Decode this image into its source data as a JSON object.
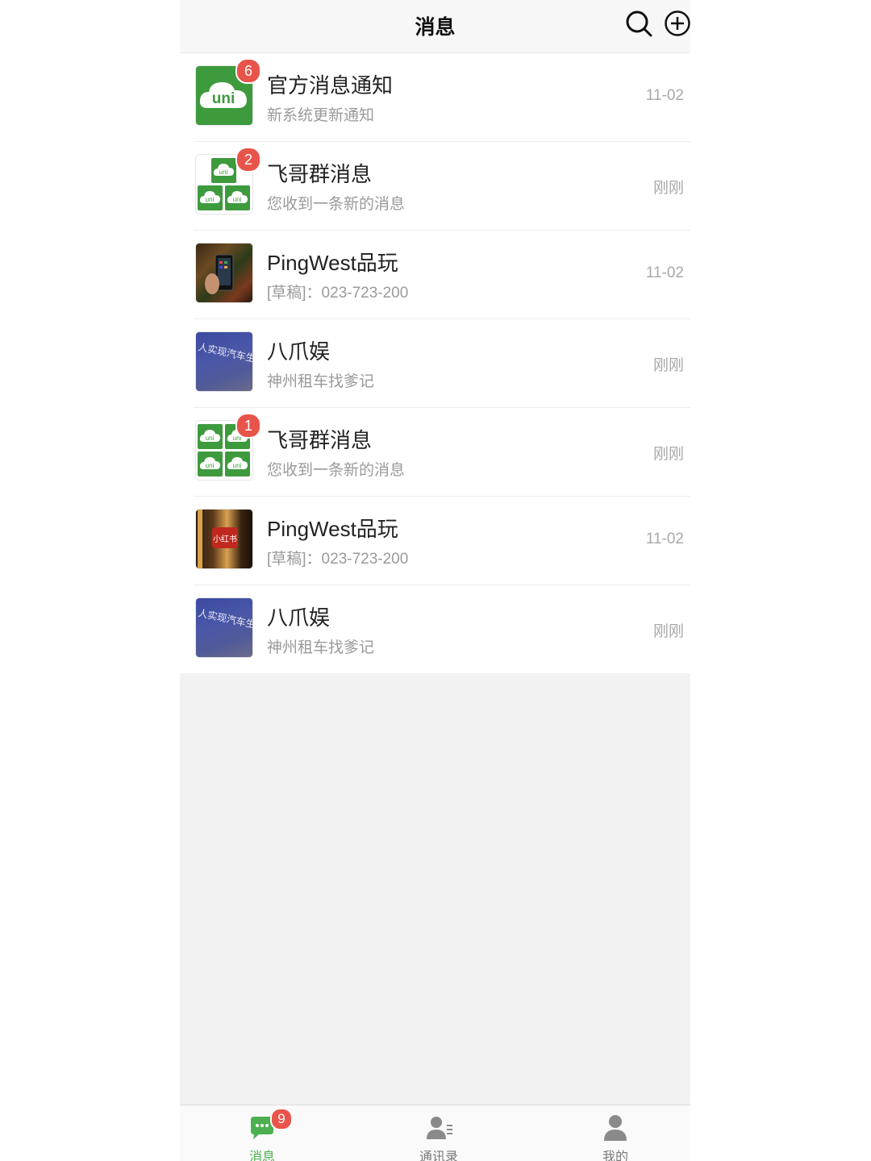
{
  "header": {
    "title": "消息",
    "search_icon": "search-icon",
    "add_icon": "plus-circle-icon"
  },
  "conversations": [
    {
      "title": "官方消息通知",
      "subtitle": "新系统更新通知",
      "time": "11-02",
      "badge": "6",
      "avatar": "uni-logo"
    },
    {
      "title": "飞哥群消息",
      "subtitle": "您收到一条新的消息",
      "time": "刚刚",
      "badge": "2",
      "avatar": "uni-group-3"
    },
    {
      "title": "PingWest品玩",
      "subtitle": "[草稿]：023-723-200",
      "time": "11-02",
      "badge": null,
      "avatar": "photo-phone"
    },
    {
      "title": "八爪娱",
      "subtitle": "神州租车找爹记",
      "time": "刚刚",
      "badge": null,
      "avatar": "photo-sign"
    },
    {
      "title": "飞哥群消息",
      "subtitle": "您收到一条新的消息",
      "time": "刚刚",
      "badge": "1",
      "avatar": "uni-group-4"
    },
    {
      "title": "PingWest品玩",
      "subtitle": "[草稿]：023-723-200",
      "time": "11-02",
      "badge": null,
      "avatar": "photo-shop"
    },
    {
      "title": "八爪娱",
      "subtitle": "神州租车找爹记",
      "time": "刚刚",
      "badge": null,
      "avatar": "photo-sign"
    }
  ],
  "avatar_text": {
    "uni": "uni",
    "sign": "人实现汽车生",
    "shop": "小红书"
  },
  "tabbar": {
    "tabs": [
      {
        "label": "消息",
        "icon": "chat-bubble-icon",
        "active": true,
        "badge": "9"
      },
      {
        "label": "通讯录",
        "icon": "contacts-icon",
        "active": false
      },
      {
        "label": "我的",
        "icon": "person-icon",
        "active": false
      }
    ]
  },
  "colors": {
    "accent": "#4caf50",
    "badge": "#e8544a",
    "uni_green": "#3d9a3d"
  }
}
